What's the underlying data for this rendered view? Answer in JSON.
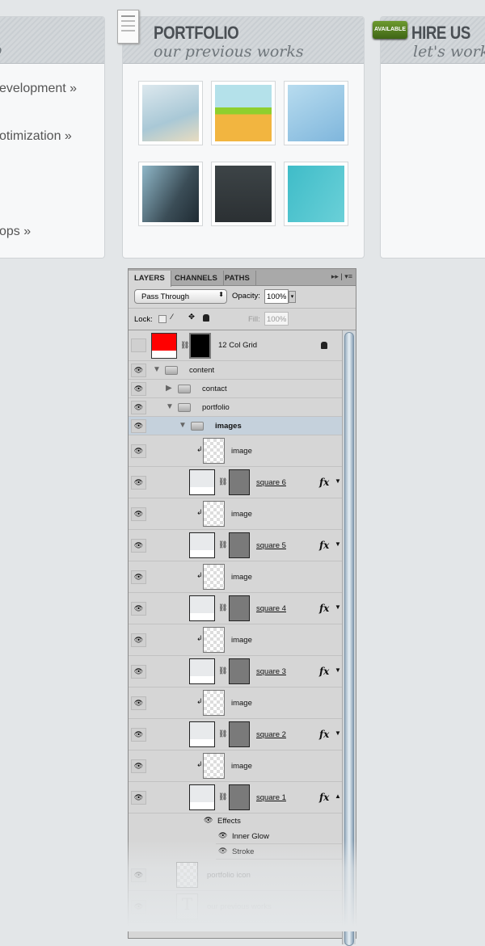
{
  "cards": {
    "left": {
      "sub": "o",
      "links": [
        "evelopment »",
        "otimization »",
        "ops »"
      ]
    },
    "portfolio": {
      "title": "PORTFOLIO",
      "sub": "our previous works",
      "thumbs": [
        "site-blue",
        "site-create",
        "design-instruct",
        "man-portrait",
        "dark-site",
        "tiffanys"
      ]
    },
    "hire": {
      "badge": "AVAILABLE",
      "title": "HIRE US",
      "sub": "let's work"
    }
  },
  "panel": {
    "tabs": [
      "LAYERS",
      "CHANNELS",
      "PATHS"
    ],
    "blend_mode": "Pass Through",
    "opacity_label": "Opacity:",
    "opacity": "100%",
    "lock_label": "Lock:",
    "fill_label": "Fill:",
    "fill": "100%",
    "layers": [
      {
        "type": "grid",
        "name": "12 Col Grid",
        "visible": false
      },
      {
        "type": "group",
        "name": "content",
        "depth": 0,
        "open": true
      },
      {
        "type": "group",
        "name": "contact",
        "depth": 1,
        "open": false
      },
      {
        "type": "group",
        "name": "portfolio",
        "depth": 1,
        "open": true
      },
      {
        "type": "group",
        "name": "images",
        "depth": 2,
        "open": true,
        "selected": true
      },
      {
        "type": "clip",
        "name": "image"
      },
      {
        "type": "square",
        "name": "square 6"
      },
      {
        "type": "clip",
        "name": "image"
      },
      {
        "type": "square",
        "name": "square 5"
      },
      {
        "type": "clip",
        "name": "image"
      },
      {
        "type": "square",
        "name": "square 4"
      },
      {
        "type": "clip",
        "name": "image"
      },
      {
        "type": "square",
        "name": "square 3"
      },
      {
        "type": "clip",
        "name": "image"
      },
      {
        "type": "square",
        "name": "square 2"
      },
      {
        "type": "clip",
        "name": "image"
      },
      {
        "type": "square",
        "name": "square 1",
        "expanded": true
      },
      {
        "type": "effects",
        "name": "Effects"
      },
      {
        "type": "effect",
        "name": "Inner Glow"
      },
      {
        "type": "effect",
        "name": "Stroke"
      },
      {
        "type": "pixel",
        "name": "portfolio icon"
      },
      {
        "type": "text",
        "name": "our previous works"
      }
    ]
  },
  "colors": {
    "grid_red": "#ff0000",
    "selected_row": "#c5d1dc",
    "badge_green": "#4e7a1f"
  }
}
